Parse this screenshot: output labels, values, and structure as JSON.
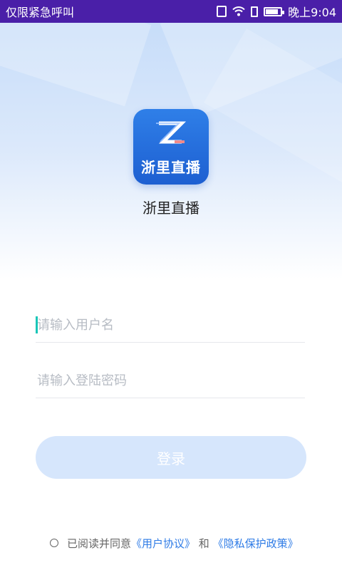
{
  "status_bar": {
    "carrier_text": "仅限紧急呼叫",
    "time": "晚上9:04",
    "battery_level": 0.85
  },
  "app": {
    "logo_text": "浙里直播",
    "name": "浙里直播"
  },
  "form": {
    "username_placeholder": "请输入用户名",
    "password_placeholder": "请输入登陆密码",
    "login_label": "登录"
  },
  "agreement": {
    "prefix": "已阅读并同意",
    "user_agreement": "《用户协议》",
    "and": " 和 ",
    "privacy_policy": "《隐私保护政策》"
  },
  "colors": {
    "status_bar": "#4a1fa8",
    "primary": "#2e7be6",
    "button_disabled": "#d6e6fc",
    "caret": "#19c6b8"
  }
}
